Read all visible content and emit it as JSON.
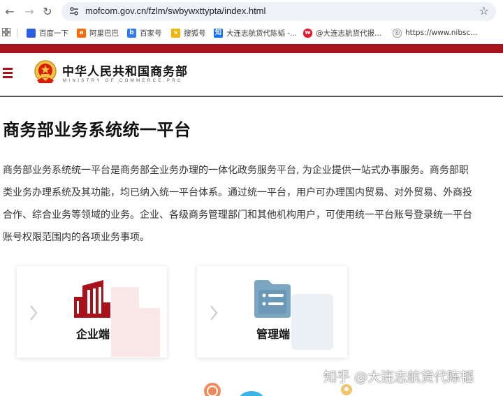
{
  "browser": {
    "url": "mofcom.gov.cn/fzlm/swbywxttypta/index.html",
    "bookmarks": [
      {
        "label": "百度一下",
        "icon": "baidu-icon",
        "color": "#2f5bea"
      },
      {
        "label": "阿里巴巴",
        "icon": "alibaba-icon",
        "color": "#ff6a00"
      },
      {
        "label": "百家号",
        "icon": "baijiahao-icon",
        "color": "#2f7bf6"
      },
      {
        "label": "搜狐号",
        "icon": "sohu-icon",
        "color": "#f4b400"
      },
      {
        "label": "大连志航货代陈韬 -...",
        "icon": "zhihu-icon",
        "color": "#1772f6"
      },
      {
        "label": "@大连志航货代报...",
        "icon": "weibo-icon",
        "color": "#e6162d"
      },
      {
        "label": "https://www.nibsc...",
        "icon": "globe-icon",
        "color": "#5f6368"
      }
    ]
  },
  "site": {
    "name": "中华人民共和国商务部",
    "name_en": "MINISTRY OF COMMERCE.PRC",
    "brand_color": "#a8121a"
  },
  "page": {
    "title": "商务部业务系统统一平台",
    "description_lines": [
      "商务部业务系统统一平台是商务部全业务办理的一体化政务服务平台, 为企业提供一站式办事服务。商务部职",
      "类业务办理系统及其功能，均已纳入统一平台体系。通过统一平台，用户可办理国内贸易、对外贸易、外商投",
      "合作、综合业务等领域的业务。企业、各级商务管理部门和其他机构用户，可使用统一平台账号登录统一平台",
      "账号权限范围内的各项业务事项。"
    ]
  },
  "cards": [
    {
      "label": "企业端",
      "icon": "enterprise-building-icon"
    },
    {
      "label": "管理端",
      "icon": "management-folder-icon"
    }
  ],
  "watermark": "知乎 @大连志航货代陈韬"
}
